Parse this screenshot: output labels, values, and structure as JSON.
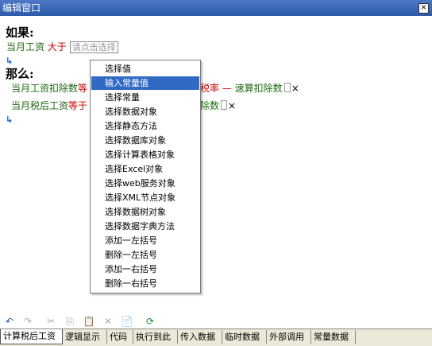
{
  "window": {
    "title": "编辑窗口",
    "close_glyph": "×"
  },
  "if_section": {
    "title": "如果:",
    "condition": {
      "field": "当月工资",
      "operator": "大于",
      "placeholder": "请点击选择"
    }
  },
  "then_section": {
    "title": "那么:",
    "rules": [
      {
        "left": "当月工资扣除数",
        "op": "等",
        "right_op": "税率",
        "minus": "—",
        "right_field": "速算扣除数",
        "delete": "×"
      },
      {
        "left": "当月税后工资",
        "op": "等于",
        "right_field": "除数",
        "delete": "×"
      }
    ],
    "add_arrow": "↳"
  },
  "context_menu": {
    "selected_index": 1,
    "items": [
      "选择值",
      "输入常量值",
      "选择常量",
      "选择数据对象",
      "选择静态方法",
      "选择数据库对象",
      "选择计算表格对象",
      "选择Excel对象",
      "选择web服务对象",
      "选择XML节点对象",
      "选择数据树对象",
      "选择数据字典方法",
      "添加一左括号",
      "删除一左括号",
      "添加一右括号",
      "删除一右括号"
    ]
  },
  "toolbar": {
    "undo": "↶",
    "redo": "↷",
    "cut": "✂",
    "copy": "⎘",
    "paste": "📋",
    "delete": "✕",
    "properties": "📄",
    "refresh": "⟳"
  },
  "tabs": {
    "active_index": 0,
    "items": [
      "计算税后工资",
      "逻辑显示",
      "代码",
      "执行到此",
      "传入数据",
      "临时数据",
      "外部调用",
      "常量数据"
    ]
  }
}
